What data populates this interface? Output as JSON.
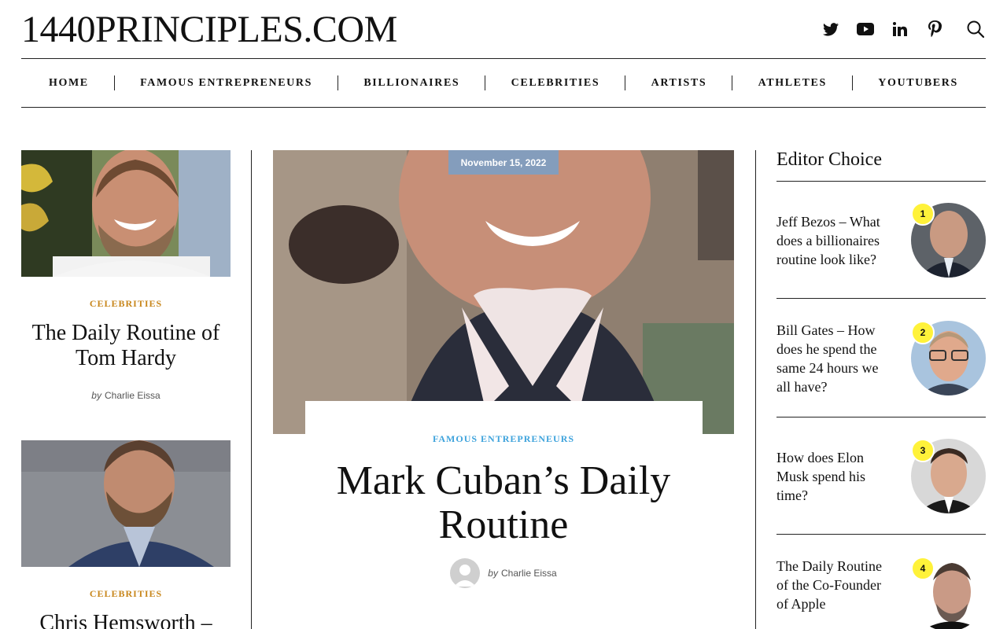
{
  "site": {
    "logo": "1440PRINCIPLES.COM"
  },
  "social": [
    "twitter-icon",
    "youtube-icon",
    "linkedin-icon",
    "pinterest-icon",
    "search-icon"
  ],
  "nav": [
    "HOME",
    "FAMOUS ENTREPRENEURS",
    "BILLIONAIRES",
    "CELEBRITIES",
    "ARTISTS",
    "ATHLETES",
    "YOUTUBERS"
  ],
  "left": [
    {
      "category": "CELEBRITIES",
      "title": "The Daily Routine of Tom Hardy",
      "by": "by",
      "author": "Charlie Eissa"
    },
    {
      "category": "CELEBRITIES",
      "title": "Chris Hemsworth –"
    }
  ],
  "featured": {
    "date": "November 15, 2022",
    "category": "FAMOUS ENTREPRENEURS",
    "title": "Mark Cuban’s Daily Routine",
    "by": "by",
    "author": "Charlie Eissa"
  },
  "editor_choice": {
    "heading": "Editor Choice",
    "items": [
      {
        "num": "1",
        "title": "Jeff Bezos – What does a billionaires routine look like?"
      },
      {
        "num": "2",
        "title": "Bill Gates – How does he spend the same 24 hours we all have?"
      },
      {
        "num": "3",
        "title": "How does Elon Musk spend his time?"
      },
      {
        "num": "4",
        "title": "The Daily Routine of the Co-Founder of Apple"
      }
    ]
  },
  "colors": {
    "category_gold": "#c8871c",
    "category_blue": "#3ea3dc",
    "badge_yellow": "#fff23a"
  }
}
